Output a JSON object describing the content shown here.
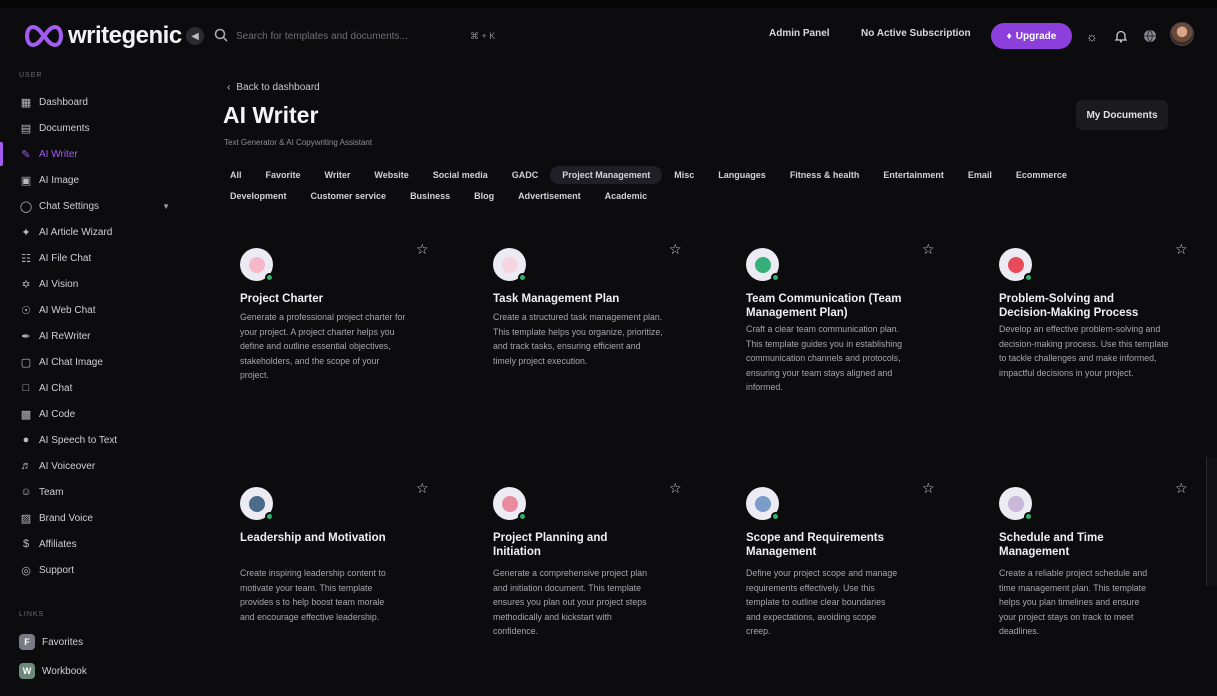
{
  "app": {
    "logo_text": "writegenic",
    "brand_color": "#a35cf0"
  },
  "header": {
    "search_placeholder": "Search for templates and documents...",
    "shortcut": "⌘ + K",
    "admin_panel": "Admin Panel",
    "subscription": "No Active Subscription",
    "upgrade": "Upgrade"
  },
  "sidebar": {
    "section_user": "USER",
    "section_links": "LINKS",
    "items": [
      {
        "label": "Dashboard",
        "icon": "dashboard-icon"
      },
      {
        "label": "Documents",
        "icon": "folder-icon"
      },
      {
        "label": "AI Writer",
        "icon": "writer-icon"
      },
      {
        "label": "AI Image",
        "icon": "image-icon"
      },
      {
        "label": "Chat Settings",
        "icon": "chat-icon"
      },
      {
        "label": "AI Article Wizard",
        "icon": "wizard-icon"
      },
      {
        "label": "AI File Chat",
        "icon": "file-icon"
      },
      {
        "label": "AI Vision",
        "icon": "vision-icon"
      },
      {
        "label": "AI Web Chat",
        "icon": "globe-icon"
      },
      {
        "label": "AI ReWriter",
        "icon": "pen-icon"
      },
      {
        "label": "AI Chat Image",
        "icon": "chat-image-icon"
      },
      {
        "label": "AI Chat",
        "icon": "chat-bubble-icon"
      },
      {
        "label": "AI Code",
        "icon": "code-icon"
      },
      {
        "label": "AI Speech to Text",
        "icon": "mic-icon"
      },
      {
        "label": "AI Voiceover",
        "icon": "speaker-icon"
      },
      {
        "label": "Team",
        "icon": "user-icon"
      },
      {
        "label": "Brand Voice",
        "icon": "brand-icon"
      },
      {
        "label": "Affiliates",
        "icon": "dollar-icon"
      },
      {
        "label": "Support",
        "icon": "support-icon"
      }
    ],
    "links": [
      {
        "label": "Favorites",
        "badge": "F"
      },
      {
        "label": "Workbook",
        "badge": "W"
      }
    ]
  },
  "main": {
    "back": "Back to dashboard",
    "title": "AI Writer",
    "subtitle": "Text Generator & AI Copywriting Assistant",
    "my_documents": "My Documents",
    "filters_row1": [
      "All",
      "Favorite",
      "Writer",
      "Website",
      "Social media",
      "GADC",
      "Project Management",
      "Misc",
      "Languages",
      "Fitness & health",
      "Entertainment",
      "Email",
      "Ecommerce"
    ],
    "filters_row2": [
      "Development",
      "Customer service",
      "Business",
      "Blog",
      "Advertisement",
      "Academic"
    ],
    "selected_filter": "Project Management",
    "cards": [
      {
        "title": "Project Charter",
        "desc": "Generate a professional project charter for your project. A project charter helps you define and outline essential objectives, stakeholders, and the scope of your project.",
        "icon_color": "#f4b8c8"
      },
      {
        "title": "Task Management Plan",
        "desc": "Create a structured task management plan. This template helps you organize, prioritize, and track tasks, ensuring efficient and timely project execution.",
        "icon_color": "#f5d5e0"
      },
      {
        "title": "Team Communication (Team Management Plan)",
        "desc": "Craft a clear team communication plan. This template guides you in establishing communication channels and protocols, ensuring your team stays aligned and informed.",
        "icon_color": "#35b07a"
      },
      {
        "title": "Problem-Solving and Decision-Making Process",
        "desc": "Develop an effective problem-solving and decision-making process. Use this template to tackle challenges and make informed, impactful decisions in your project.",
        "icon_color": "#e84a5a"
      },
      {
        "title": "Leadership and Motivation",
        "desc": "Create inspiring leadership content to motivate your team. This template provides s to help boost team morale and encourage effective leadership.",
        "icon_color": "#4a6c8a"
      },
      {
        "title": "Project Planning and Initiation",
        "desc": "Generate a comprehensive project plan and initiation document. This template ensures you plan out your project steps methodically and kickstart with confidence.",
        "icon_color": "#e88aa0"
      },
      {
        "title": "Scope and Requirements Management",
        "desc": "Define your project scope and manage requirements effectively. Use this template to outline clear boundaries and expectations, avoiding scope creep.",
        "icon_color": "#7a9cc8"
      },
      {
        "title": "Schedule and Time Management",
        "desc": "Create a reliable project schedule and time management plan. This template helps you plan timelines and ensure your project stays on track to meet deadlines.",
        "icon_color": "#c9b8d8"
      }
    ]
  }
}
